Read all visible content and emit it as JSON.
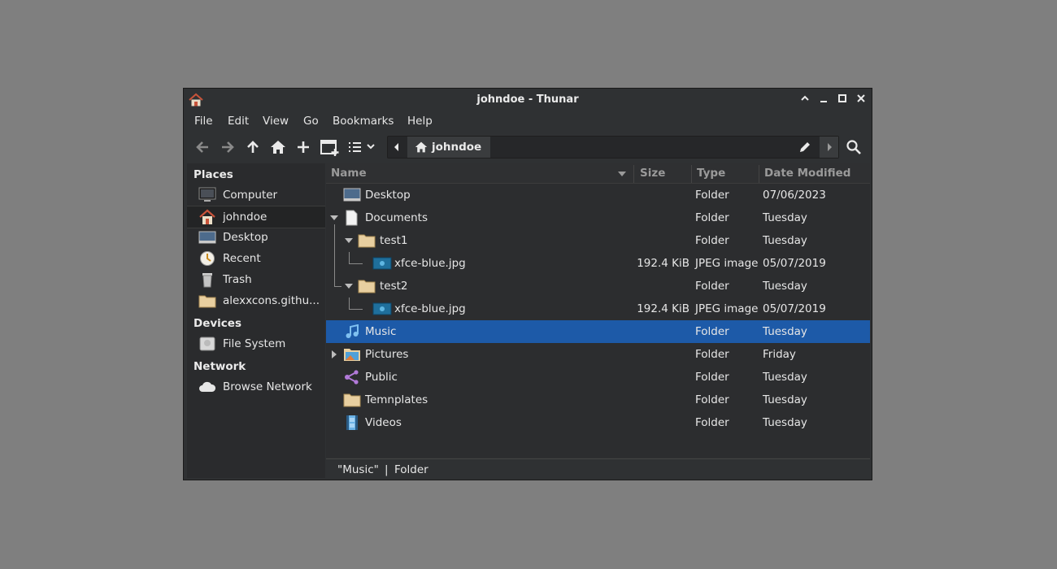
{
  "window": {
    "title": "johndoe - Thunar"
  },
  "menu": [
    "File",
    "Edit",
    "View",
    "Go",
    "Bookmarks",
    "Help"
  ],
  "pathbar": {
    "current": "johndoe"
  },
  "sidebar": {
    "places_title": "Places",
    "places": [
      {
        "label": "Computer",
        "icon": "computer-icon"
      },
      {
        "label": "johndoe",
        "icon": "home-icon"
      },
      {
        "label": "Desktop",
        "icon": "desktop-icon"
      },
      {
        "label": "Recent",
        "icon": "recent-icon"
      },
      {
        "label": "Trash",
        "icon": "trash-icon"
      },
      {
        "label": "alexxcons.githu...",
        "icon": "folder-icon"
      }
    ],
    "devices_title": "Devices",
    "devices": [
      {
        "label": "File System",
        "icon": "drive-icon"
      }
    ],
    "network_title": "Network",
    "network": [
      {
        "label": "Browse Network",
        "icon": "cloud-icon"
      }
    ]
  },
  "columns": {
    "name": "Name",
    "size": "Size",
    "type": "Type",
    "date": "Date Modified"
  },
  "files": [
    {
      "name": "Desktop",
      "size": "",
      "type": "Folder",
      "date": "07/06/2023",
      "icon": "desktop-icon",
      "depth": 0
    },
    {
      "name": "Documents",
      "size": "",
      "type": "Folder",
      "date": "Tuesday",
      "icon": "document-icon",
      "depth": 0,
      "expanded": true
    },
    {
      "name": "test1",
      "size": "",
      "type": "Folder",
      "date": "Tuesday",
      "icon": "folder-icon",
      "depth": 1,
      "expanded": true
    },
    {
      "name": "xfce-blue.jpg",
      "size": "192.4 KiB",
      "type": "JPEG image",
      "date": "05/07/2019",
      "icon": "image-icon",
      "depth": 2
    },
    {
      "name": "test2",
      "size": "",
      "type": "Folder",
      "date": "Tuesday",
      "icon": "folder-icon",
      "depth": 1,
      "expanded": true
    },
    {
      "name": "xfce-blue.jpg",
      "size": "192.4 KiB",
      "type": "JPEG image",
      "date": "05/07/2019",
      "icon": "image-icon",
      "depth": 2
    },
    {
      "name": "Music",
      "size": "",
      "type": "Folder",
      "date": "Tuesday",
      "icon": "music-icon",
      "depth": 0,
      "selected": true
    },
    {
      "name": "Pictures",
      "size": "",
      "type": "Folder",
      "date": "Friday",
      "icon": "pictures-icon",
      "depth": 0,
      "collapsed": true
    },
    {
      "name": "Public",
      "size": "",
      "type": "Folder",
      "date": "Tuesday",
      "icon": "share-icon",
      "depth": 0
    },
    {
      "name": "Temnplates",
      "size": "",
      "type": "Folder",
      "date": "Tuesday",
      "icon": "folder-icon",
      "depth": 0
    },
    {
      "name": "Videos",
      "size": "",
      "type": "Folder",
      "date": "Tuesday",
      "icon": "video-icon",
      "depth": 0
    }
  ],
  "status": {
    "name": "\"Music\"",
    "sep": "|",
    "type": "Folder"
  },
  "colors": {
    "selection": "#1d5aa8",
    "background": "#2f3133"
  }
}
